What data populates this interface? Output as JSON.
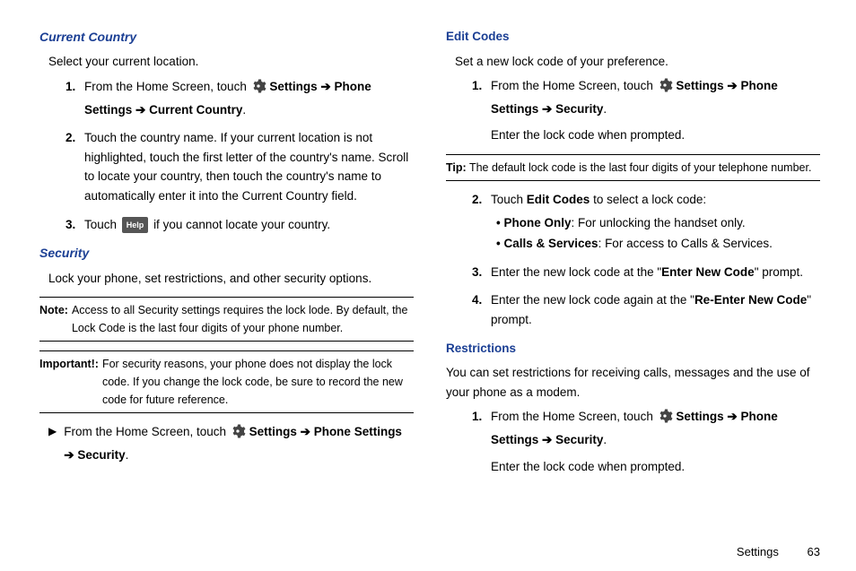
{
  "left": {
    "h1": "Current Country",
    "intro1": "Select your current location.",
    "s1_pre": "From the Home Screen, touch ",
    "path_settings": "Settings",
    "arrow": "➔",
    "path_phone_settings": "Phone Settings",
    "path_current_country": "Current Country",
    "s2": "Touch the country name. If your current location is not highlighted, touch the first letter of the country's name. Scroll to locate your country, then touch the country's name to automatically enter it into the Current Country field.",
    "s3_pre": "Touch ",
    "help_label": "Help",
    "s3_post": " if you cannot locate your country.",
    "h2": "Security",
    "intro2": "Lock your phone, set restrictions, and other security options.",
    "note1_label": "Note:",
    "note1_body": "Access to all Security settings requires the lock lode. By default, the Lock Code is the last four digits of your phone number.",
    "note2_label": "Important!:",
    "note2_body": "For security reasons, your phone does not display the lock code. If you change the lock code, be sure to record the new code for future reference.",
    "arrow_item_pre": "From the Home Screen, touch ",
    "path_security": "Security"
  },
  "right": {
    "h1": "Edit Codes",
    "intro1": "Set a new lock code of your preference.",
    "s1_pre": "From the Home Screen, touch ",
    "s1_post": "Enter the lock code when prompted.",
    "tip_label": "Tip:",
    "tip_body": "The default lock code is the last four digits of your telephone number.",
    "s2_pre": "Touch ",
    "s2_bold": "Edit Codes",
    "s2_post": " to select a lock code:",
    "b1_bold": "Phone Only",
    "b1_post": ": For unlocking the handset only.",
    "b2_bold": "Calls & Services",
    "b2_post": ": For access to Calls & Services.",
    "s3_pre": "Enter the new lock code at the \"",
    "s3_bold": "Enter New Code",
    "s3_post": "\" prompt.",
    "s4_pre": "Enter the new lock code again at the \"",
    "s4_bold": "Re-Enter New Code",
    "s4_post": "\" prompt.",
    "h2": "Restrictions",
    "intro2": "You can set restrictions for receiving calls, messages and the use of your phone as a modem.",
    "r1_pre": "From the Home Screen, touch ",
    "r1_post": "Enter the lock code when prompted."
  },
  "footer": {
    "section": "Settings",
    "page": "63"
  },
  "period": "."
}
